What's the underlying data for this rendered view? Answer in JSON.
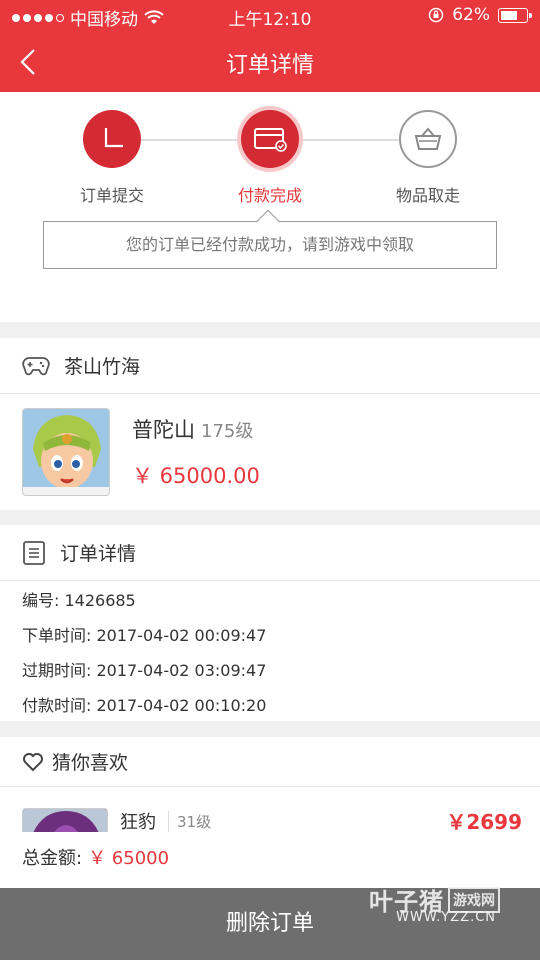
{
  "status_bar": {
    "carrier": "中国移动",
    "time": "上午12:10",
    "battery_percent": "62%",
    "battery_level": 0.62
  },
  "nav": {
    "title": "订单详情",
    "back_icon": "chevron-left-icon"
  },
  "progress": {
    "steps": [
      {
        "label": "订单提交",
        "icon": "clock-icon",
        "state": "done"
      },
      {
        "label": "付款完成",
        "icon": "card-check-icon",
        "state": "active"
      },
      {
        "label": "物品取走",
        "icon": "basket-icon",
        "state": "pending"
      }
    ],
    "notice": "您的订单已经付款成功，请到游戏中领取"
  },
  "server": {
    "icon": "gamepad-icon",
    "name": "茶山竹海"
  },
  "product": {
    "name": "普陀山",
    "level": "175级",
    "price": "￥ 65000.00"
  },
  "order_details": {
    "icon": "document-icon",
    "title": "订单详情",
    "rows": [
      "编号: 1426685",
      "下单时间: 2017-04-02 00:09:47",
      "过期时间: 2017-04-02 03:09:47",
      "付款时间: 2017-04-02 00:10:20"
    ]
  },
  "recommend": {
    "icon": "heart-icon",
    "title": "猜你喜欢",
    "items": [
      {
        "name": "狂豹",
        "level": "31级",
        "price": "￥2699"
      }
    ]
  },
  "total": {
    "label": "总金额:",
    "amount": "￥ 65000"
  },
  "delete_button": "删除订单",
  "watermark": {
    "logo": "叶子猪",
    "box": "游戏网",
    "url": "WWW.YZZ.CN"
  },
  "colors": {
    "brand_red": "#e8383d",
    "button_gray": "#6e6e6e"
  }
}
